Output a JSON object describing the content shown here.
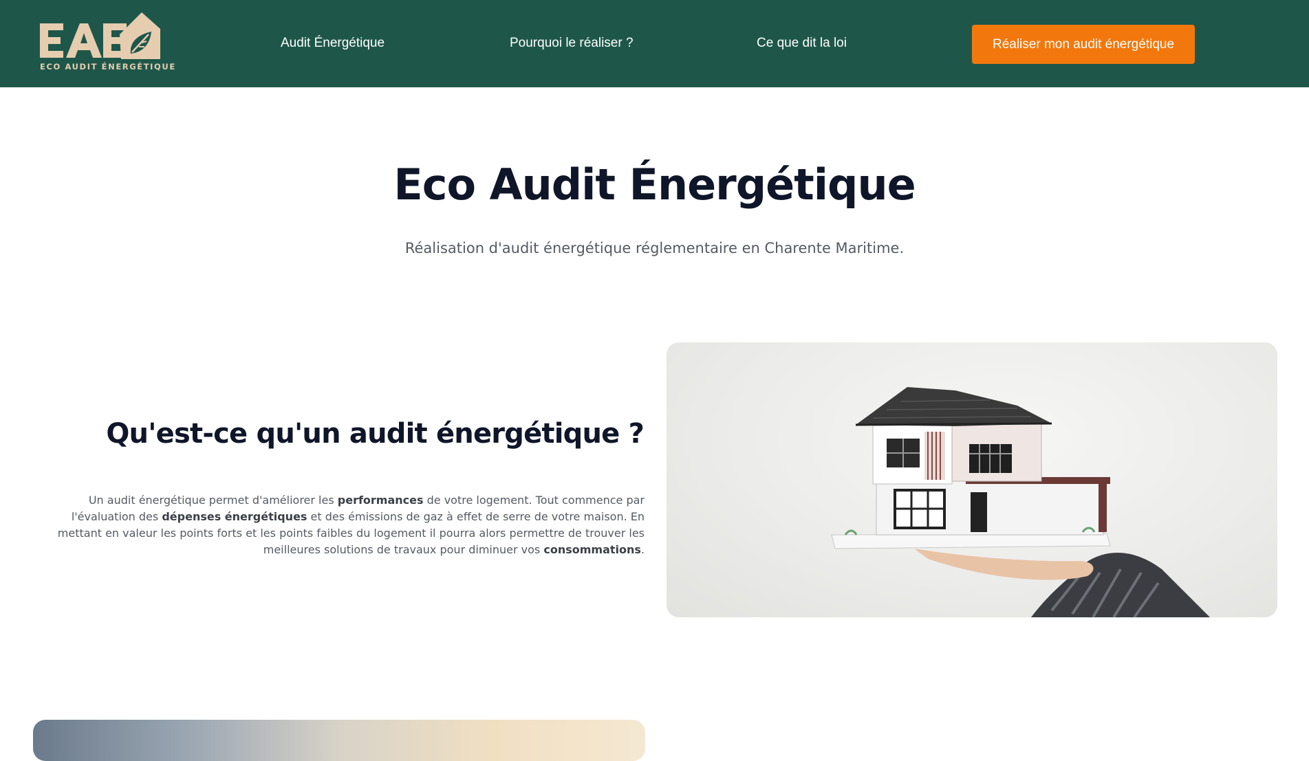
{
  "header": {
    "logo_letters": "EAE",
    "logo_subtitle": "ECO AUDIT ÉNERGÉTIQUE",
    "nav": [
      {
        "label": "Audit Énergétique"
      },
      {
        "label": "Pourquoi le réaliser ?"
      },
      {
        "label": "Ce que dit la loi"
      }
    ],
    "cta_label": "Réaliser mon audit énergétique"
  },
  "hero": {
    "title": "Eco Audit Énergétique",
    "subtitle": "Réalisation d'audit énergétique réglementaire en Charente Maritime."
  },
  "section": {
    "title": "Qu'est-ce qu'un audit énergétique ?",
    "paragraph": {
      "p1": "Un audit énergétique permet d'améliorer les ",
      "b1": "performances",
      "p2": " de votre logement. Tout commence par l'évaluation des ",
      "b2": "dépenses énergétiques",
      "p3": " et des émissions de gaz à effet de serre de votre maison. En mettant en valeur les points forts et les points faibles du logement il pourra alors permettre de trouver les meilleures solutions de travaux pour diminuer vos ",
      "b3": "consommations",
      "p4": "."
    }
  },
  "colors": {
    "header_bg": "#1e574a",
    "cta_bg": "#f2780d",
    "logo_color": "#e6cdb0",
    "title_color": "#0f1629",
    "body_text": "#555a62"
  }
}
